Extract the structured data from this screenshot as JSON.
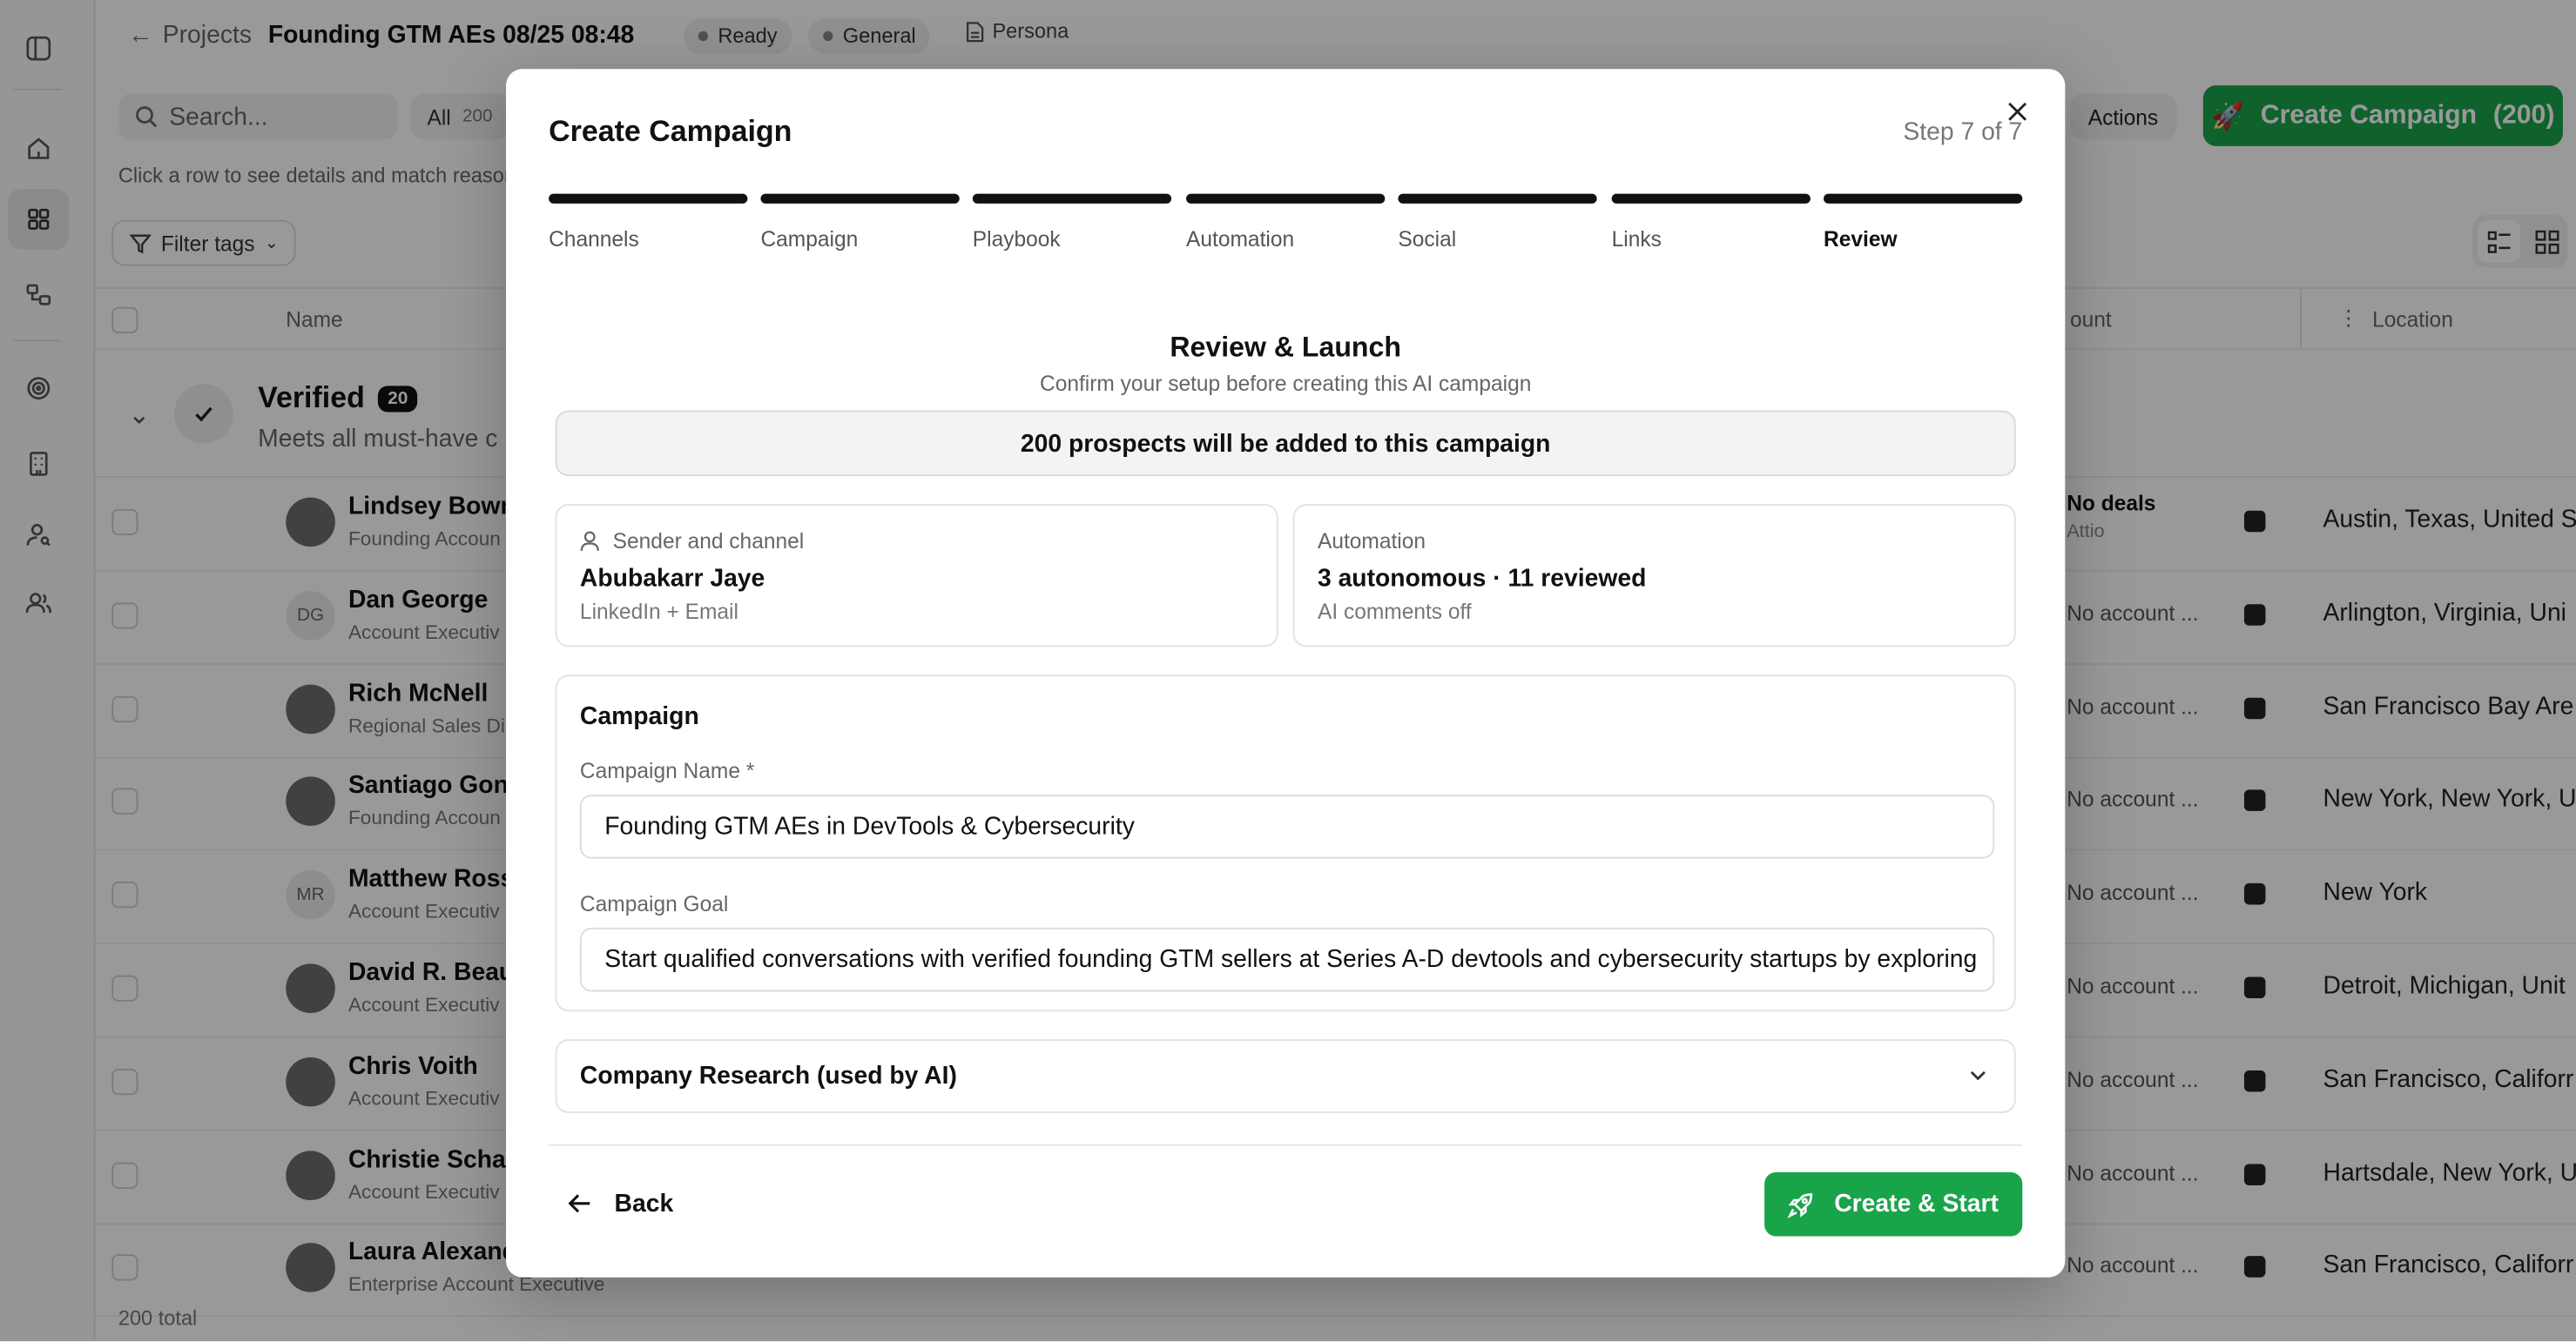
{
  "header": {
    "back_label": "Projects",
    "project_title": "Founding GTM AEs 08/25 08:48",
    "status_chip": "Ready",
    "type_chip": "General",
    "persona_chip": "Persona"
  },
  "toolbar": {
    "search_placeholder": "Search...",
    "all_tab_label": "All",
    "all_tab_count": "200",
    "hint": "Click a row to see details and match reasons",
    "actions_label": "Actions",
    "create_campaign_label": "Create Campaign",
    "create_campaign_count": "(200)",
    "filter_label": "Filter tags"
  },
  "table": {
    "col_name": "Name",
    "col_account": "ount",
    "col_location": "Location",
    "group": {
      "title": "Verified",
      "count": "20",
      "subtitle": "Meets all must-have c"
    },
    "rows": [
      {
        "name": "Lindsey Bown",
        "title": "Founding Accoun",
        "initials": "",
        "account": "No deals",
        "account_sub": "Attio",
        "location": "Austin, Texas, United S"
      },
      {
        "name": "Dan George",
        "title": "Account Executiv",
        "initials": "DG",
        "account": "No account ...",
        "account_sub": "",
        "location": "Arlington, Virginia, Uni"
      },
      {
        "name": "Rich McNell",
        "title": "Regional Sales Di",
        "initials": "",
        "account": "No account ...",
        "account_sub": "",
        "location": "San Francisco Bay Are"
      },
      {
        "name": "Santiago Gon:",
        "title": "Founding Accoun",
        "initials": "",
        "account": "No account ...",
        "account_sub": "",
        "location": "New York, New York, U"
      },
      {
        "name": "Matthew Ross",
        "title": "Account Executiv",
        "initials": "MR",
        "account": "No account ...",
        "account_sub": "",
        "location": "New York"
      },
      {
        "name": "David R. Beau",
        "title": "Account Executiv",
        "initials": "",
        "account": "No account ...",
        "account_sub": "",
        "location": "Detroit, Michigan, Unit"
      },
      {
        "name": "Chris Voith",
        "title": "Account Executiv",
        "initials": "",
        "account": "No account ...",
        "account_sub": "",
        "location": "San Francisco, Califorr"
      },
      {
        "name": "Christie Schad",
        "title": "Account Executiv",
        "initials": "",
        "account": "No account ...",
        "account_sub": "",
        "location": "Hartsdale, New York, U"
      },
      {
        "name": "Laura Alexand",
        "title": "Enterprise Account Executive",
        "initials": "",
        "account": "No account ...",
        "account_sub": "",
        "location": "San Francisco, Califorr"
      }
    ],
    "total": "200 total"
  },
  "modal": {
    "title": "Create Campaign",
    "step_text": "Step 7 of 7",
    "steps": [
      {
        "label": "Channels"
      },
      {
        "label": "Campaign"
      },
      {
        "label": "Playbook"
      },
      {
        "label": "Automation"
      },
      {
        "label": "Social"
      },
      {
        "label": "Links"
      },
      {
        "label": "Review"
      }
    ],
    "review_title": "Review & Launch",
    "review_subtitle": "Confirm your setup before creating this AI campaign",
    "prospect_banner": "200 prospects will be added to this campaign",
    "sender_card": {
      "heading": "Sender and channel",
      "main": "Abubakarr Jaye",
      "sub": "LinkedIn + Email"
    },
    "automation_card": {
      "heading": "Automation",
      "main": "3 autonomous · 11 reviewed",
      "sub": "AI comments off"
    },
    "campaign_section": {
      "title": "Campaign",
      "name_label": "Campaign Name *",
      "name_value": "Founding GTM AEs in DevTools & Cybersecurity",
      "goal_label": "Campaign Goal",
      "goal_value": "Start qualified conversations with verified founding GTM sellers at Series A-D devtools and cybersecurity startups by exploring"
    },
    "research_label": "Company Research (used by AI)",
    "back_label": "Back",
    "start_label": "Create & Start"
  },
  "colors": {
    "accent_green": "#19a44a",
    "progress_bar": "#111111"
  }
}
